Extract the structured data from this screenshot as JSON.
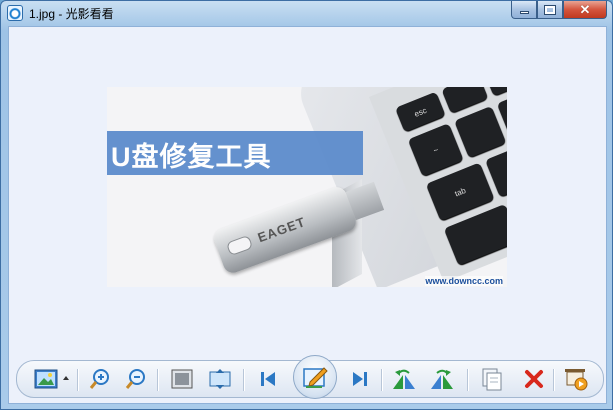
{
  "window": {
    "title": "1.jpg - 光影看看"
  },
  "image": {
    "banner_text": "U盘修复工具",
    "brand_text": "EAGET",
    "watermark": "www.downcc.com",
    "keys": [
      "esc",
      "~",
      "tab"
    ]
  },
  "toolbar": {
    "buttons": [
      {
        "name": "image-menu-button",
        "icon": "picture-icon"
      },
      {
        "name": "zoom-in-button",
        "icon": "zoom-in-icon"
      },
      {
        "name": "zoom-out-button",
        "icon": "zoom-out-icon"
      },
      {
        "name": "actual-size-button",
        "icon": "actual-size-icon"
      },
      {
        "name": "fit-window-button",
        "icon": "fit-window-icon"
      },
      {
        "name": "previous-button",
        "icon": "previous-icon"
      },
      {
        "name": "edit-button",
        "icon": "edit-icon"
      },
      {
        "name": "next-button",
        "icon": "next-icon"
      },
      {
        "name": "rotate-left-button",
        "icon": "rotate-left-icon"
      },
      {
        "name": "rotate-right-button",
        "icon": "rotate-right-icon"
      },
      {
        "name": "copy-button",
        "icon": "copy-icon"
      },
      {
        "name": "delete-button",
        "icon": "delete-icon"
      },
      {
        "name": "slideshow-button",
        "icon": "slideshow-icon"
      }
    ]
  },
  "colors": {
    "accent": "#5d8ccc",
    "delete": "#d8281c",
    "rotate": "#2a9a3c"
  }
}
